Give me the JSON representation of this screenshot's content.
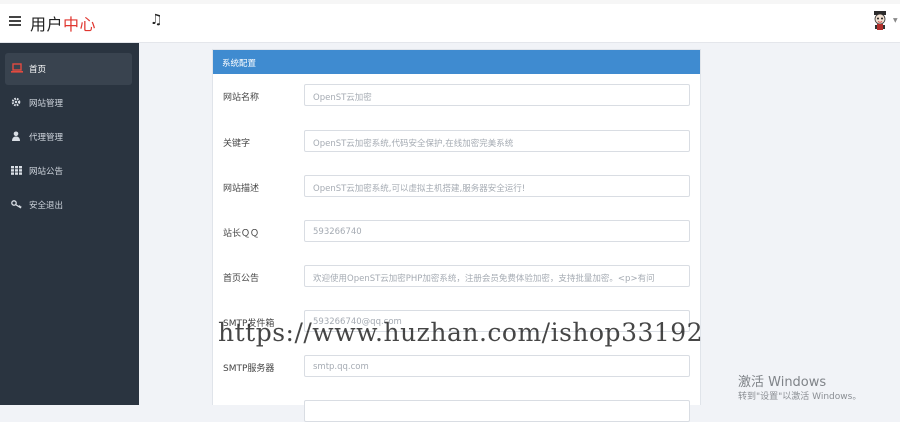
{
  "header": {
    "brand_main": "用户",
    "brand_accent": "中心",
    "music_icon": "♫"
  },
  "sidebar": {
    "items": [
      {
        "label": "首页",
        "icon": "laptop-icon",
        "active": true
      },
      {
        "label": "网站管理",
        "icon": "gear-icon",
        "active": false
      },
      {
        "label": "代理管理",
        "icon": "user-icon",
        "active": false
      },
      {
        "label": "网站公告",
        "icon": "grid-icon",
        "active": false
      },
      {
        "label": "安全退出",
        "icon": "key-icon",
        "active": false
      }
    ]
  },
  "panel": {
    "title": "系统配置",
    "fields": [
      {
        "label": "网站名称",
        "value": "OpenST云加密"
      },
      {
        "label": "关键字",
        "value": "OpenST云加密系统,代码安全保护,在线加密完美系统"
      },
      {
        "label": "网站描述",
        "value": "OpenST云加密系统,可以虚拟主机搭建,服务器安全运行!"
      },
      {
        "label": "站长ＱＱ",
        "value": "593266740"
      },
      {
        "label": "首页公告",
        "value": "欢迎使用OpenST云加密PHP加密系统，注册会员免费体验加密，支持批量加密。<p>有问"
      },
      {
        "label": "SMTP发件箱",
        "value": "593266740@qq.com"
      },
      {
        "label": "SMTP服务器",
        "value": "smtp.qq.com"
      },
      {
        "label": "",
        "value": ""
      }
    ]
  },
  "watermark": {
    "text": "https://www.huzhan.com/ishop33192"
  },
  "windows_activation": {
    "title": "激活 Windows",
    "subtitle": "转到\"设置\"以激活 Windows。"
  },
  "colors": {
    "sidebar_bg": "#2a3440",
    "panel_header": "#3f8bd0",
    "brand_accent": "#e0362f"
  }
}
